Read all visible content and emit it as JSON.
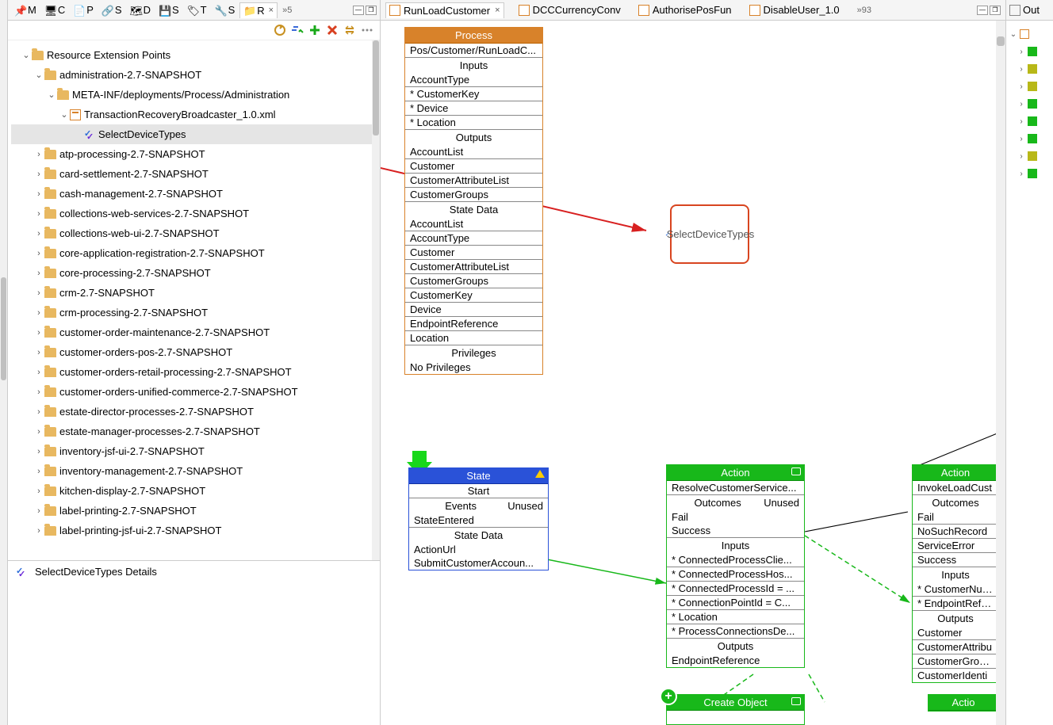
{
  "leftTabs": {
    "items": [
      {
        "label": "M"
      },
      {
        "label": "C"
      },
      {
        "label": "P"
      },
      {
        "label": "S"
      },
      {
        "label": "D"
      },
      {
        "label": "S"
      },
      {
        "label": "T"
      },
      {
        "label": "S"
      },
      {
        "label": "R"
      }
    ],
    "overflow": "»5",
    "activeClose": "×"
  },
  "tree": {
    "root": "Resource Extension Points",
    "admin": "administration-2.7-SNAPSHOT",
    "meta": "META-INF/deployments/Process/Administration",
    "xml": "TransactionRecoveryBroadcaster_1.0.xml",
    "selected": "SelectDeviceTypes",
    "folders": [
      "atp-processing-2.7-SNAPSHOT",
      "card-settlement-2.7-SNAPSHOT",
      "cash-management-2.7-SNAPSHOT",
      "collections-web-services-2.7-SNAPSHOT",
      "collections-web-ui-2.7-SNAPSHOT",
      "core-application-registration-2.7-SNAPSHOT",
      "core-processing-2.7-SNAPSHOT",
      "crm-2.7-SNAPSHOT",
      "crm-processing-2.7-SNAPSHOT",
      "customer-order-maintenance-2.7-SNAPSHOT",
      "customer-orders-pos-2.7-SNAPSHOT",
      "customer-orders-retail-processing-2.7-SNAPSHOT",
      "customer-orders-unified-commerce-2.7-SNAPSHOT",
      "estate-director-processes-2.7-SNAPSHOT",
      "estate-manager-processes-2.7-SNAPSHOT",
      "inventory-jsf-ui-2.7-SNAPSHOT",
      "inventory-management-2.7-SNAPSHOT",
      "kitchen-display-2.7-SNAPSHOT",
      "label-printing-2.7-SNAPSHOT",
      "label-printing-jsf-ui-2.7-SNAPSHOT"
    ]
  },
  "details": {
    "title": "SelectDeviceTypes Details"
  },
  "centerTabs": {
    "items": [
      "RunLoadCustomer",
      "DCCCurrencyConv",
      "AuthorisePosFun",
      "DisableUser_1.0"
    ],
    "active": 0,
    "close": "×",
    "overflow": "»93"
  },
  "rightTab": {
    "label": "Out"
  },
  "dropBox": {
    "label": "SelectDeviceTypes"
  },
  "process": {
    "header": "Process",
    "path": "Pos/Customer/RunLoadC...",
    "inputsTitle": "Inputs",
    "inputs": [
      "AccountType",
      "* CustomerKey",
      "* Device",
      "* Location"
    ],
    "outputsTitle": "Outputs",
    "outputs": [
      "AccountList",
      "Customer",
      "CustomerAttributeList",
      "CustomerGroups"
    ],
    "stateTitle": "State Data",
    "state": [
      "AccountList",
      "AccountType",
      "Customer",
      "CustomerAttributeList",
      "CustomerGroups",
      "CustomerKey",
      "Device",
      "EndpointReference",
      "Location"
    ],
    "privTitle": "Privileges",
    "priv": "No Privileges"
  },
  "stateNode": {
    "header": "State",
    "name": "Start",
    "eventsTitle": "Events",
    "unused": "Unused",
    "events": [
      "StateEntered"
    ],
    "stateTitle": "State Data",
    "state": [
      "ActionUrl",
      "SubmitCustomerAccoun..."
    ]
  },
  "action1": {
    "header": "Action",
    "name": "ResolveCustomerService...",
    "outcomesTitle": "Outcomes",
    "unused": "Unused",
    "outcomes": [
      "Fail",
      "Success"
    ],
    "inputsTitle": "Inputs",
    "inputs": [
      "* ConnectedProcessClie...",
      "* ConnectedProcessHos...",
      "* ConnectedProcessId = ...",
      "* ConnectionPointId = C...",
      "* Location",
      "* ProcessConnectionsDe..."
    ],
    "outputsTitle": "Outputs",
    "outputs": [
      "EndpointReference"
    ]
  },
  "action2": {
    "header": "Action",
    "name": "InvokeLoadCust",
    "outcomesTitle": "Outcomes",
    "outcomes": [
      "Fail",
      "NoSuchRecord",
      "ServiceError",
      "Success"
    ],
    "inputsTitle": "Inputs",
    "inputs": [
      "* CustomerNumb",
      "* EndpointRefere"
    ],
    "outputsTitle": "Outputs",
    "outputs": [
      "Customer",
      "CustomerAttribu",
      "CustomerGroups",
      "CustomerIdenti"
    ]
  },
  "createObj": {
    "header": "Create Object"
  },
  "action3": {
    "header": "Actio"
  }
}
